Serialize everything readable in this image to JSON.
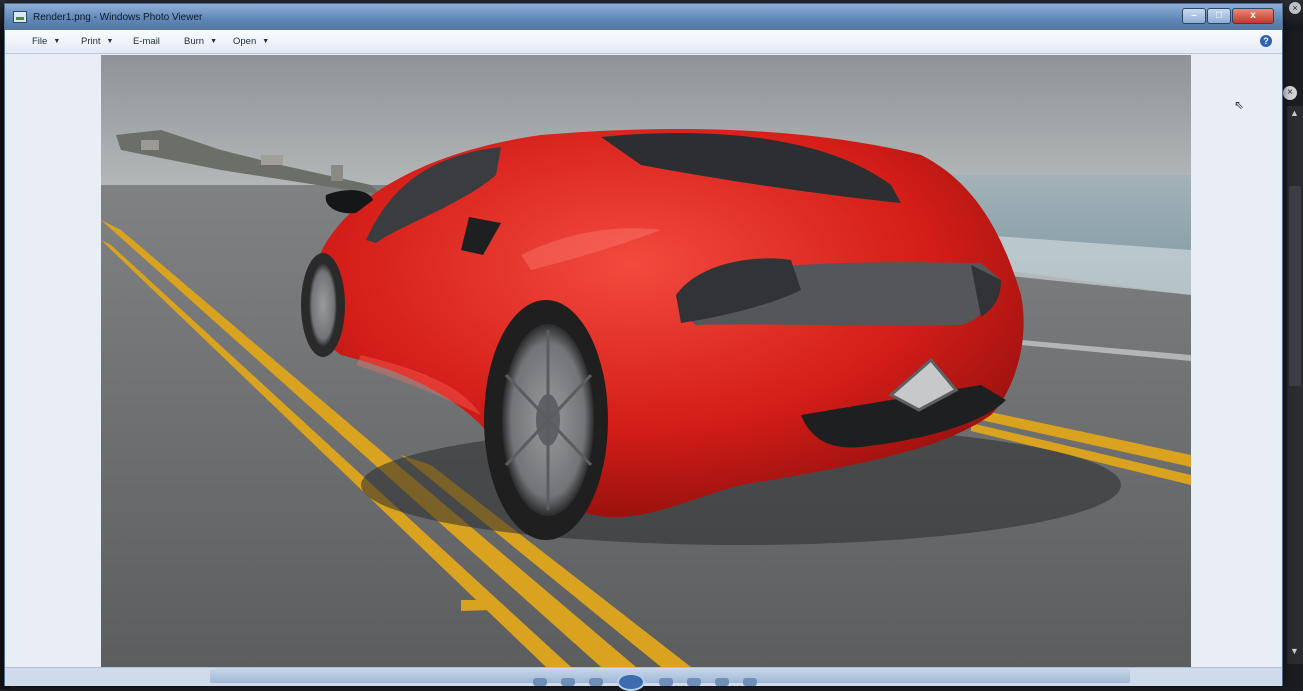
{
  "window": {
    "title": "Render1.png - Windows Photo Viewer",
    "controls": {
      "minimize": "–",
      "maximize": "□",
      "close": "x"
    }
  },
  "menu": {
    "items": [
      {
        "label": "File",
        "has_dropdown": true
      },
      {
        "label": "Print",
        "has_dropdown": true
      },
      {
        "label": "E-mail",
        "has_dropdown": false
      },
      {
        "label": "Burn",
        "has_dropdown": true
      },
      {
        "label": "Open",
        "has_dropdown": true
      }
    ],
    "caret": "▼",
    "help": "?"
  },
  "photo": {
    "subject": "red sports car render on coastal road",
    "colors": {
      "car": "#d8201c",
      "road": "#6f7072",
      "line": "#d9a21f",
      "sky": "#a4a8ab",
      "sea": "#8fa7b0"
    }
  },
  "background_app": {
    "close_glyph": "×",
    "scroll_up": "▲",
    "scroll_down": "▼"
  },
  "cursor": "⇖"
}
